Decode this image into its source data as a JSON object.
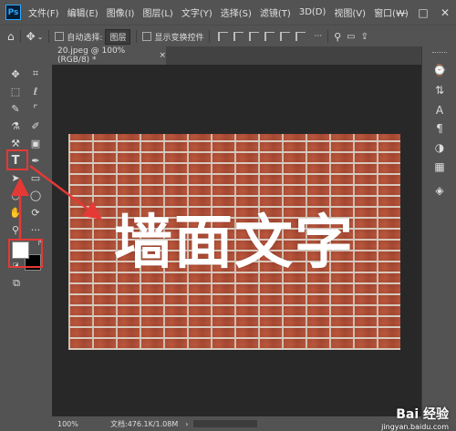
{
  "app": {
    "logo": "Ps"
  },
  "menu": [
    "文件(F)",
    "编辑(E)",
    "图像(I)",
    "图层(L)",
    "文字(Y)",
    "选择(S)",
    "滤镜(T)",
    "3D(D)",
    "视图(V)",
    "窗口(W)"
  ],
  "window_controls": {
    "minimize": "—",
    "maximize": "□",
    "close": "✕"
  },
  "options": {
    "auto_select_label": "自动选择:",
    "auto_select_value": "图层",
    "show_transform_label": "显示变换控件",
    "more": "···"
  },
  "tab": {
    "title": "20.jpeg @ 100%(RGB/8) *",
    "close": "×"
  },
  "canvas": {
    "text": "墙面文字"
  },
  "status": {
    "zoom": "100%",
    "doc_info": "文档:476.1K/1.08M",
    "arrow": "›"
  },
  "watermark": {
    "brand": "Bai 经验",
    "url": "jingyan.baidu.com"
  },
  "colors": {
    "highlight": "#e53935",
    "foreground": "#ffffff",
    "background": "#000000"
  },
  "icons": [
    "move-icon",
    "artboard-icon",
    "marquee-icon",
    "lasso-icon",
    "quick-select-icon",
    "crop-icon",
    "eyedropper-icon",
    "brush-icon",
    "stamp-icon",
    "gradient-icon",
    "pen-icon",
    "type-icon",
    "path-select-icon",
    "rectangle-icon",
    "hand-icon",
    "zoom-icon",
    "more-icon"
  ]
}
